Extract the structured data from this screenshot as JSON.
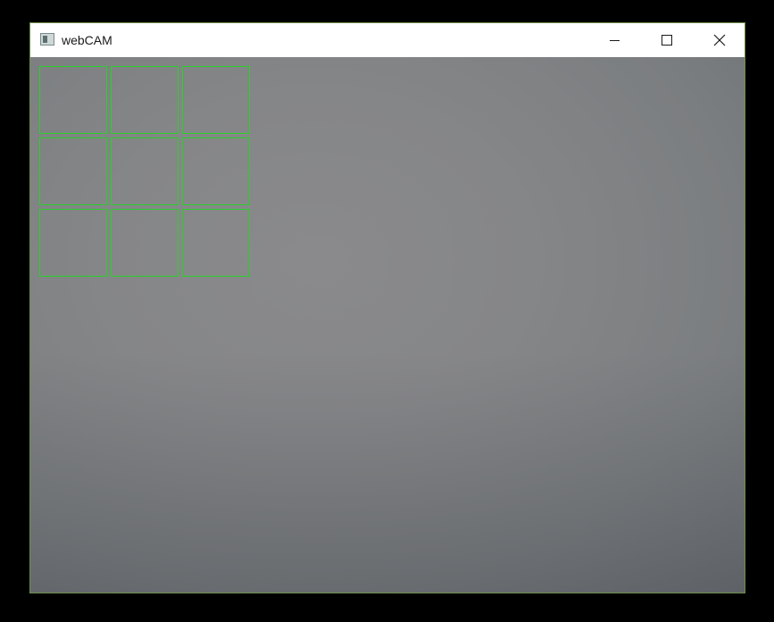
{
  "window": {
    "title": "webCAM",
    "icons": {
      "app": "app-window-icon",
      "minimize": "minimize-icon",
      "maximize": "maximize-icon",
      "close": "close-icon"
    }
  },
  "camera_view": {
    "overlay_color": "#26d326",
    "grid": {
      "rows": 3,
      "cols": 3
    }
  }
}
